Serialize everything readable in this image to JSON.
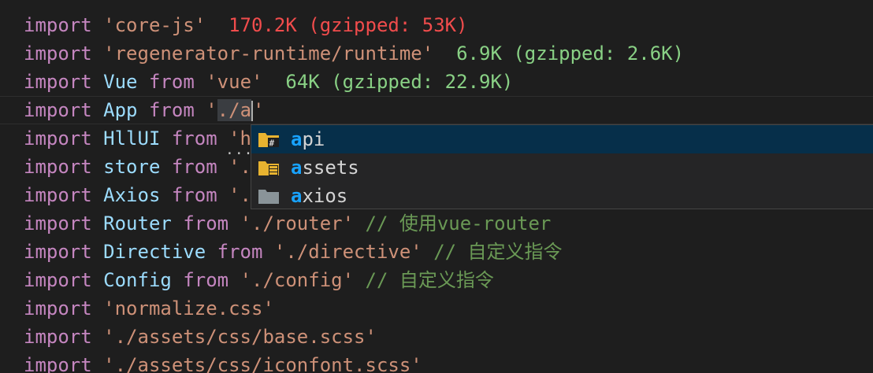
{
  "editor": {
    "lines": [
      {
        "tokens": [
          {
            "t": "import",
            "c": "kw"
          },
          {
            "t": " ",
            "c": "plain"
          },
          {
            "t": "'core-js'",
            "c": "str"
          },
          {
            "t": "  ",
            "c": "plain"
          },
          {
            "t": "170.2K (gzipped: 53K)",
            "c": "size-big"
          }
        ]
      },
      {
        "tokens": [
          {
            "t": "import",
            "c": "kw"
          },
          {
            "t": " ",
            "c": "plain"
          },
          {
            "t": "'regenerator-runtime/runtime'",
            "c": "str"
          },
          {
            "t": "  ",
            "c": "plain"
          },
          {
            "t": "6.9K (gzipped: 2.6K)",
            "c": "size-ok"
          }
        ]
      },
      {
        "tokens": [
          {
            "t": "import",
            "c": "kw"
          },
          {
            "t": " ",
            "c": "plain"
          },
          {
            "t": "Vue",
            "c": "id"
          },
          {
            "t": " ",
            "c": "plain"
          },
          {
            "t": "from",
            "c": "kw"
          },
          {
            "t": " ",
            "c": "plain"
          },
          {
            "t": "'vue'",
            "c": "str"
          },
          {
            "t": "  ",
            "c": "plain"
          },
          {
            "t": "64K (gzipped: 22.9K)",
            "c": "size-ok"
          }
        ]
      },
      {
        "tokens": [
          {
            "t": "import",
            "c": "kw"
          },
          {
            "t": " ",
            "c": "plain"
          },
          {
            "t": "App",
            "c": "id"
          },
          {
            "t": " ",
            "c": "plain"
          },
          {
            "t": "from",
            "c": "kw"
          },
          {
            "t": " ",
            "c": "plain"
          },
          {
            "t": "'",
            "c": "str"
          },
          {
            "t": "./a",
            "c": "str sel-bg"
          },
          {
            "t": "",
            "c": "cursor"
          },
          {
            "t": "'",
            "c": "str"
          }
        ]
      },
      {
        "tokens": [
          {
            "t": "import",
            "c": "kw"
          },
          {
            "t": " ",
            "c": "plain"
          },
          {
            "t": "HllUI",
            "c": "id"
          },
          {
            "t": " ",
            "c": "plain"
          },
          {
            "t": "from",
            "c": "kw"
          },
          {
            "t": " ",
            "c": "plain"
          },
          {
            "t": "'h",
            "c": "str"
          }
        ]
      },
      {
        "tokens": [
          {
            "t": "import",
            "c": "kw"
          },
          {
            "t": " ",
            "c": "plain"
          },
          {
            "t": "store",
            "c": "id"
          },
          {
            "t": " ",
            "c": "plain"
          },
          {
            "t": "from",
            "c": "kw"
          },
          {
            "t": " ",
            "c": "plain"
          },
          {
            "t": "'.",
            "c": "str"
          }
        ]
      },
      {
        "tokens": [
          {
            "t": "import",
            "c": "kw"
          },
          {
            "t": " ",
            "c": "plain"
          },
          {
            "t": "Axios",
            "c": "id"
          },
          {
            "t": " ",
            "c": "plain"
          },
          {
            "t": "from",
            "c": "kw"
          },
          {
            "t": " ",
            "c": "plain"
          },
          {
            "t": "'.",
            "c": "str"
          }
        ]
      },
      {
        "tokens": [
          {
            "t": "import",
            "c": "kw"
          },
          {
            "t": " ",
            "c": "plain"
          },
          {
            "t": "Router",
            "c": "id"
          },
          {
            "t": " ",
            "c": "plain"
          },
          {
            "t": "from",
            "c": "kw"
          },
          {
            "t": " ",
            "c": "plain"
          },
          {
            "t": "'./router'",
            "c": "str"
          },
          {
            "t": " ",
            "c": "plain"
          },
          {
            "t": "// 使用vue-router",
            "c": "cmt"
          }
        ]
      },
      {
        "tokens": [
          {
            "t": "import",
            "c": "kw"
          },
          {
            "t": " ",
            "c": "plain"
          },
          {
            "t": "Directive",
            "c": "id"
          },
          {
            "t": " ",
            "c": "plain"
          },
          {
            "t": "from",
            "c": "kw"
          },
          {
            "t": " ",
            "c": "plain"
          },
          {
            "t": "'./directive'",
            "c": "str"
          },
          {
            "t": " ",
            "c": "plain"
          },
          {
            "t": "// 自定义指令",
            "c": "cmt"
          }
        ]
      },
      {
        "tokens": [
          {
            "t": "import",
            "c": "kw"
          },
          {
            "t": " ",
            "c": "plain"
          },
          {
            "t": "Config",
            "c": "id"
          },
          {
            "t": " ",
            "c": "plain"
          },
          {
            "t": "from",
            "c": "kw"
          },
          {
            "t": " ",
            "c": "plain"
          },
          {
            "t": "'./config'",
            "c": "str"
          },
          {
            "t": " ",
            "c": "plain"
          },
          {
            "t": "// 自定义指令",
            "c": "cmt"
          }
        ]
      },
      {
        "tokens": [
          {
            "t": "import",
            "c": "kw"
          },
          {
            "t": " ",
            "c": "plain"
          },
          {
            "t": "'normalize.css'",
            "c": "str"
          }
        ]
      },
      {
        "tokens": [
          {
            "t": "import",
            "c": "kw"
          },
          {
            "t": " ",
            "c": "plain"
          },
          {
            "t": "'./assets/css/base.scss'",
            "c": "str"
          }
        ]
      },
      {
        "tokens": [
          {
            "t": "import",
            "c": "kw"
          },
          {
            "t": " ",
            "c": "plain"
          },
          {
            "t": "'./assets/css/iconfont.scss'",
            "c": "str"
          }
        ]
      }
    ],
    "ellipsis": "...",
    "colors": {
      "background": "#1e1e1e",
      "keyword": "#c586c0",
      "identifier": "#9cdcfe",
      "string": "#ce9178",
      "comment": "#6a9955",
      "size_warning": "#f14c4c",
      "size_ok": "#89d185",
      "suggest_selected": "#062f4a",
      "suggest_match": "#18a3ff",
      "folder_yellow": "#e8b330",
      "folder_gray": "#8a9499"
    }
  },
  "suggestions": {
    "items": [
      {
        "match": "a",
        "rest": "pi",
        "icon": "folder-api-icon",
        "selected": true
      },
      {
        "match": "a",
        "rest": "ssets",
        "icon": "folder-assets-icon",
        "selected": false
      },
      {
        "match": "a",
        "rest": "xios",
        "icon": "folder-icon",
        "selected": false
      }
    ]
  }
}
